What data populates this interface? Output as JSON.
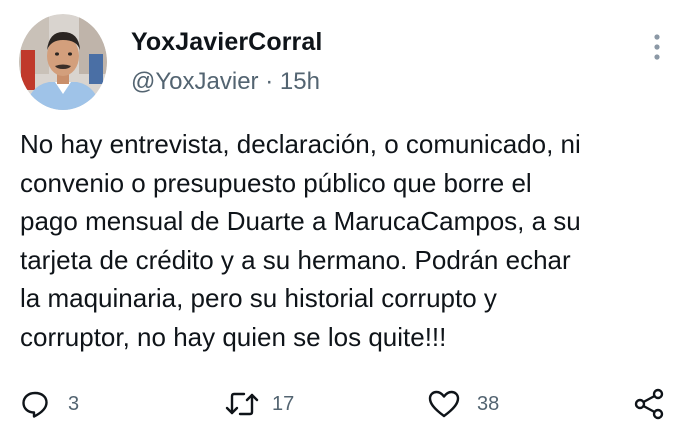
{
  "author": {
    "display_name": "YoxJavierCorral",
    "handle": "@YoxJavier",
    "separator": "·",
    "time": "15h"
  },
  "tweet": {
    "lines": [
      "No hay entrevista, declaración, o comunicado, ni",
      "convenio o presupuesto público que borre el",
      "pago mensual de Duarte a MarucaCampos, a su",
      "tarjeta de crédito y a su hermano. Podrán echar",
      "la maquinaria, pero su historial corrupto y",
      "corruptor, no hay quien se los quite!!!"
    ]
  },
  "actions": {
    "reply_count": "3",
    "retweet_count": "17",
    "like_count": "38"
  },
  "icons": {
    "reply": "reply-icon",
    "retweet": "retweet-icon",
    "like": "heart-icon",
    "share": "share-icon",
    "more": "more-options-icon"
  },
  "colors": {
    "text": "#0f1419",
    "secondary": "#536471",
    "background": "#ffffff"
  }
}
